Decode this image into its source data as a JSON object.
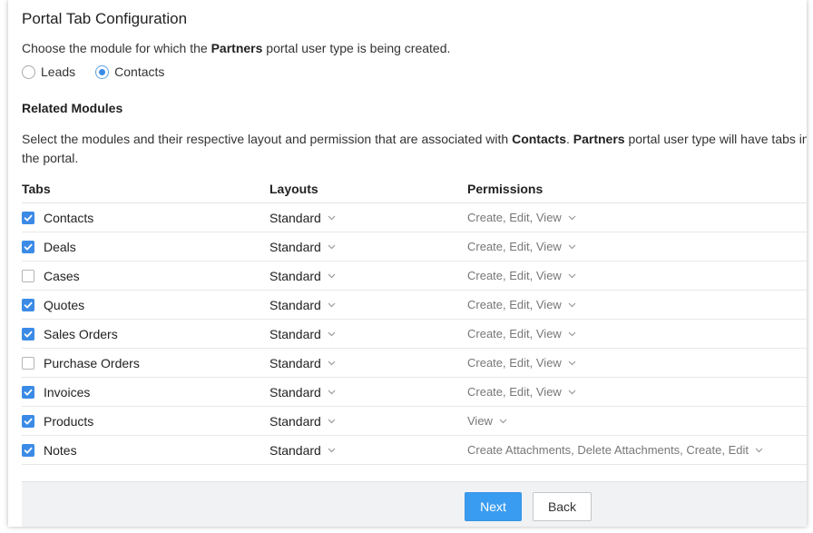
{
  "header": {
    "title": "Portal Tab Configuration"
  },
  "module_choice": {
    "prefix": "Choose the module for which the ",
    "user_type": "Partners",
    "suffix": " portal user type is being created.",
    "options": [
      {
        "label": "Leads",
        "selected": false
      },
      {
        "label": "Contacts",
        "selected": true
      }
    ]
  },
  "related": {
    "title": "Related Modules",
    "desc_prefix": "Select the modules and their respective layout and permission that are associated with ",
    "desc_module": "Contacts",
    "desc_sep": ". ",
    "desc_user_type": "Partners",
    "desc_suffix": " portal user type will have tabs in the portal."
  },
  "table": {
    "columns": {
      "tabs": "Tabs",
      "layouts": "Layouts",
      "permissions": "Permissions"
    },
    "rows": [
      {
        "name": "Contacts",
        "checked": true,
        "layout": "Standard",
        "permission": "Create, Edit, View"
      },
      {
        "name": "Deals",
        "checked": true,
        "layout": "Standard",
        "permission": "Create, Edit, View"
      },
      {
        "name": "Cases",
        "checked": false,
        "layout": "Standard",
        "permission": "Create, Edit, View"
      },
      {
        "name": "Quotes",
        "checked": true,
        "layout": "Standard",
        "permission": "Create, Edit, View"
      },
      {
        "name": "Sales Orders",
        "checked": true,
        "layout": "Standard",
        "permission": "Create, Edit, View"
      },
      {
        "name": "Purchase Orders",
        "checked": false,
        "layout": "Standard",
        "permission": "Create, Edit, View"
      },
      {
        "name": "Invoices",
        "checked": true,
        "layout": "Standard",
        "permission": "Create, Edit, View"
      },
      {
        "name": "Products",
        "checked": true,
        "layout": "Standard",
        "permission": "View"
      },
      {
        "name": "Notes",
        "checked": true,
        "layout": "Standard",
        "permission": "Create Attachments, Delete Attachments, Create, Edit"
      }
    ]
  },
  "footer": {
    "next_label": "Next",
    "back_label": "Back"
  },
  "colors": {
    "accent": "#3b8be6",
    "next_button": "#3a9cf0",
    "footer_bg": "#f1f2f4"
  }
}
